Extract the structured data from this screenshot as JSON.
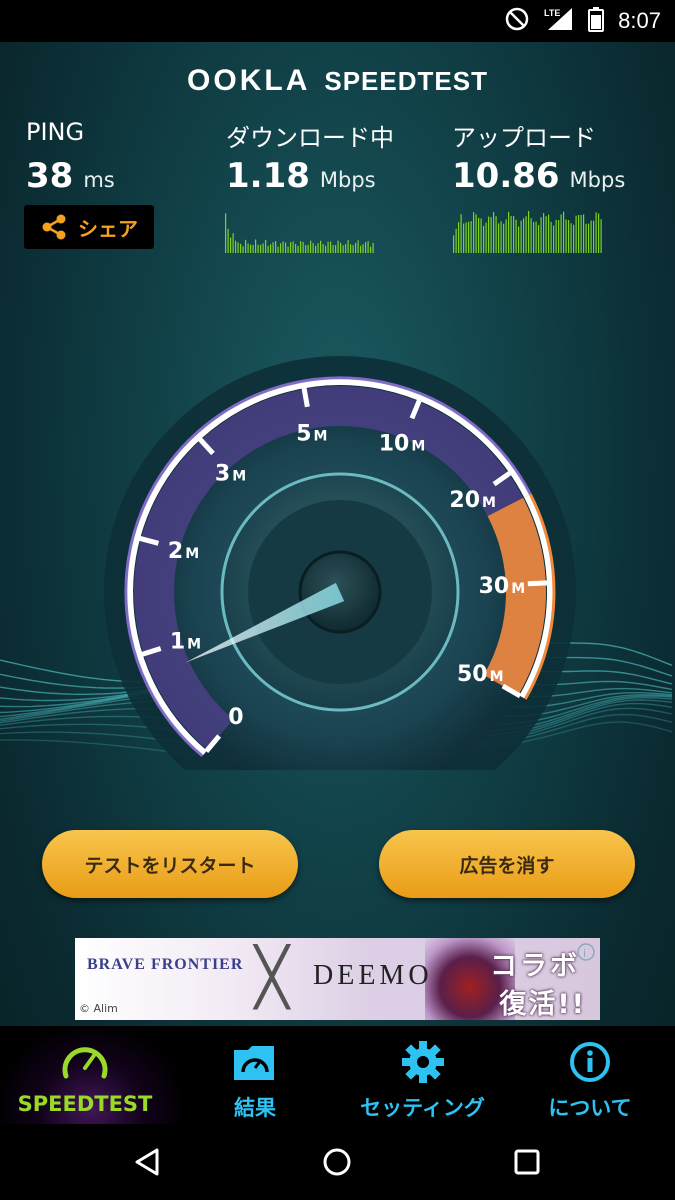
{
  "status_bar": {
    "time": "8:07",
    "network": "LTE"
  },
  "brand": {
    "ookla": "OOKLA",
    "speedtest": "SPEEDTEST"
  },
  "ping": {
    "label": "PING",
    "value": "38",
    "unit": "ms"
  },
  "download": {
    "label": "ダウンロード中",
    "value": "1.18",
    "unit": "Mbps"
  },
  "upload": {
    "label": "アップロード",
    "value": "10.86",
    "unit": "Mbps"
  },
  "share_button": {
    "label": "シェア"
  },
  "gauge": {
    "tick_labels": [
      "0",
      "1M",
      "2M",
      "3M",
      "5M",
      "10M",
      "20M",
      "30M",
      "50M"
    ],
    "current_value_mbps": 1.18
  },
  "actions": {
    "restart_label": "テストをリスタート",
    "remove_ads_label": "広告を消す"
  },
  "ad": {
    "brand_a": "BRAVE FRONTIER",
    "brand_b": "DEEMO",
    "headline_1": "コラボ",
    "headline_2": "復活!!",
    "copyright": "© Alim"
  },
  "tabs": [
    {
      "label": "SPEEDTEST",
      "icon": "speedometer-icon",
      "active": true
    },
    {
      "label": "結果",
      "icon": "results-folder-icon",
      "active": false
    },
    {
      "label": "セッティング",
      "icon": "gear-icon",
      "active": false
    },
    {
      "label": "について",
      "icon": "info-icon",
      "active": false
    }
  ],
  "colors": {
    "accent_orange": "#f6a21e",
    "active_tab": "#9bd929",
    "inactive_tab": "#2ec2f2",
    "download_graph": "#7ed321",
    "upload_graph": "#7ed321",
    "gauge_arc_purple": "#9b7be8",
    "gauge_arc_orange": "#f08a3c"
  }
}
